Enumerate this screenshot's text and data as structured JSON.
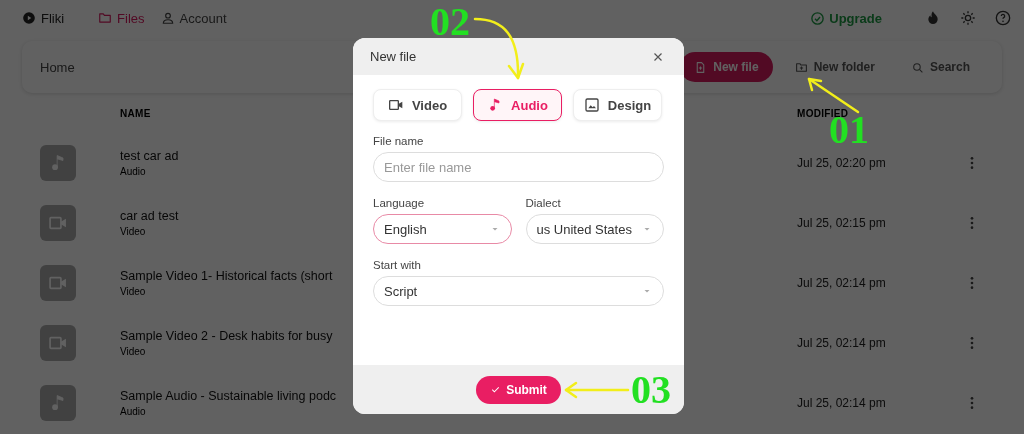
{
  "nav": {
    "brand": "Fliki",
    "items": [
      {
        "label": "Files",
        "kind": "folder",
        "selected": true
      },
      {
        "label": "Account",
        "kind": "user",
        "selected": false
      }
    ],
    "upgrade": "Upgrade"
  },
  "toolbar": {
    "breadcrumb": "Home",
    "actions": [
      {
        "label": "New file",
        "kind": "primary"
      },
      {
        "label": "New folder",
        "kind": "folder"
      },
      {
        "label": "Search",
        "kind": "search"
      }
    ]
  },
  "table": {
    "columns": [
      "NAME",
      "MODIFIED"
    ],
    "rows": [
      {
        "title": "test car ad",
        "type": "Audio",
        "kind": "audio",
        "modified": "Jul 25, 02:20 pm"
      },
      {
        "title": "car ad test",
        "type": "Video",
        "kind": "video",
        "modified": "Jul 25, 02:15 pm"
      },
      {
        "title": "Sample Video 1- Historical facts (short",
        "type": "Video",
        "kind": "video",
        "modified": "Jul 25, 02:14 pm"
      },
      {
        "title": "Sample Video 2 - Desk habits for busy",
        "type": "Video",
        "kind": "video",
        "modified": "Jul 25, 02:14 pm"
      },
      {
        "title": "Sample Audio - Sustainable living podc",
        "type": "Audio",
        "kind": "audio",
        "modified": "Jul 25, 02:14 pm"
      }
    ]
  },
  "dialog": {
    "title": "New file",
    "types": [
      {
        "label": "Video",
        "kind": "video",
        "selected": false
      },
      {
        "label": "Audio",
        "kind": "audio",
        "selected": true
      },
      {
        "label": "Design",
        "kind": "design",
        "selected": false
      }
    ],
    "field_rows": [
      [
        {
          "label": "File name",
          "kind": "text",
          "placeholder": "Enter file name",
          "focused": false
        }
      ],
      [
        {
          "label": "Language",
          "kind": "select",
          "value": "English",
          "focused": true
        },
        {
          "label": "Dialect",
          "kind": "select",
          "value": "us United States",
          "focused": false
        }
      ],
      [
        {
          "label": "Start with",
          "kind": "select",
          "value": "Script",
          "focused": false
        }
      ]
    ],
    "submit": "Submit"
  },
  "callouts": [
    {
      "label": "01"
    },
    {
      "label": "02"
    },
    {
      "label": "03"
    }
  ]
}
